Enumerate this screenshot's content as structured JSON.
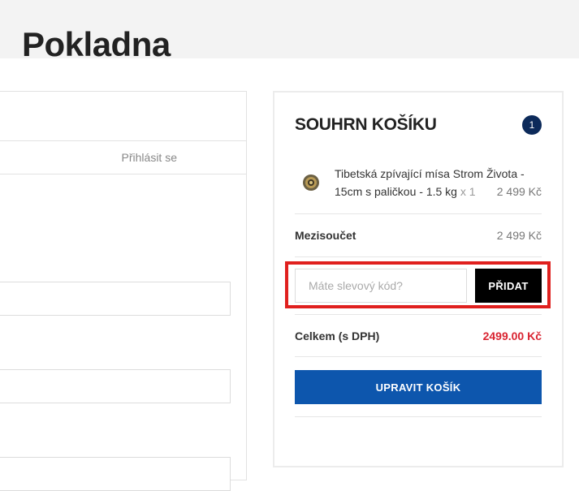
{
  "page": {
    "title": "Pokladna"
  },
  "login": {
    "tab_label": "Přihlásit se"
  },
  "cart_summary": {
    "title": "SOUHRN KOŠÍKU",
    "item_count": "1",
    "items": [
      {
        "name": "Tibetská zpívající mísa Strom Života - 15cm s paličkou - 1.5 kg",
        "qty": "x 1",
        "price": "2 499 Kč"
      }
    ],
    "subtotal_label": "Mezisoučet",
    "subtotal_value": "2 499 Kč",
    "coupon": {
      "placeholder": "Máte slevový kód?",
      "button_label": "PŘIDAT"
    },
    "total_label": "Celkem (s DPH)",
    "total_value": "2499.00 Kč",
    "edit_cart_label": "UPRAVIT KOŠÍK"
  },
  "colors": {
    "header_bg": "#f3f3f3",
    "badge_bg": "#0c2a5a",
    "total_price": "#d92431",
    "primary_button": "#0d56ad",
    "highlight": "#e0201e"
  }
}
